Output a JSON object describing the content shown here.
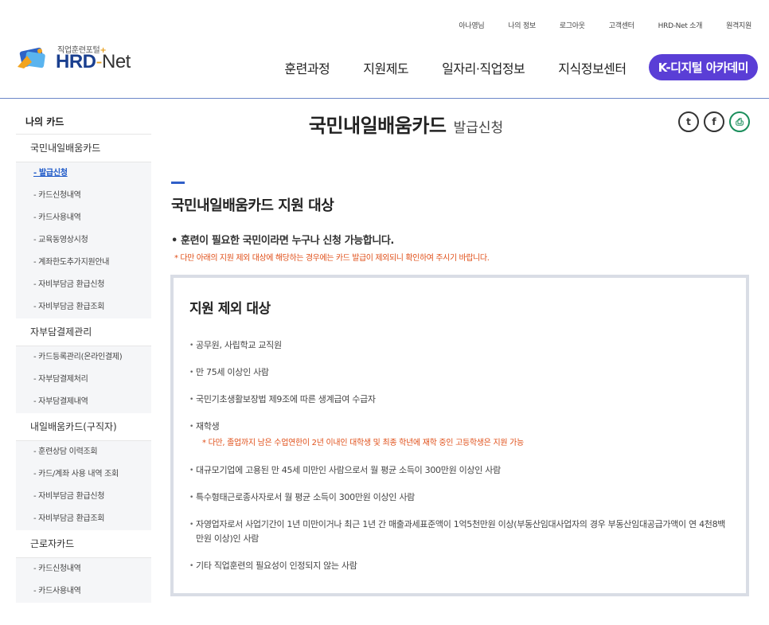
{
  "utility_links": [
    "아나영님",
    "나의 정보",
    "로그아웃",
    "고객센터",
    "HRD-Net 소개",
    "원격지원"
  ],
  "logo": {
    "subtitle": "직업훈련포털",
    "plus": "+",
    "brand_hrd": "HRD",
    "brand_dash": "-",
    "brand_net": "Net"
  },
  "gnb": [
    "훈련과정",
    "지원제도",
    "일자리·직업정보",
    "지식정보센터"
  ],
  "gnb_highlight": "K-디지털 아카데미",
  "sidebar": {
    "title": "나의 카드",
    "groups": [
      {
        "label": "국민내일배움카드",
        "items": [
          "- 발급신청",
          "- 카드신청내역",
          "- 카드사용내역",
          "- 교육동영상시청",
          "- 계좌한도추가지원안내",
          "- 자비부담금 환급신청",
          "- 자비부담금 환급조회"
        ]
      },
      {
        "label": "자부담결제관리",
        "items": [
          "- 카드등록관리(온라인결제)",
          "- 자부담결제처리",
          "- 자부담결제내역"
        ]
      },
      {
        "label": "내일배움카드(구직자)",
        "items": [
          "- 훈련상담 이력조회",
          "- 카드/계좌 사용 내역 조회",
          "- 자비부담금 환급신청",
          "- 자비부담금 환급조회"
        ]
      },
      {
        "label": "근로자카드",
        "items": [
          "- 카드신청내역",
          "- 카드사용내역"
        ]
      }
    ]
  },
  "page_title": {
    "main": "국민내일배움카드",
    "sub": "발급신청"
  },
  "share_icons": [
    "twitter-icon",
    "facebook-icon",
    "print-icon"
  ],
  "section_title": "국민내일배움카드 지원 대상",
  "lead": "훈련이 필요한 국민이라면 누구나 신청 가능합니다.",
  "note": "* 다만 아래의 지원 제외 대상에 해당하는 경우에는 카드 발급이 제외되니 확인하여 주시기 바랍니다.",
  "box": {
    "title": "지원 제외 대상",
    "items": [
      "공무원, 사립학교 교직원",
      "만 75세 이상인 사람",
      "국민기초생활보장법 제9조에 따른 생계급여 수급자",
      "재학생",
      "대규모기업에 고용된 만 45세 미만인 사람으로서 월 평균 소득이 300만원 이상인 사람",
      "특수형태근로종사자로서 월 평균 소득이 300만원 이상인 사람",
      "자영업자로서 사업기간이 1년 미만이거나 최근 1년 간 매출과세표준액이 1억5천만원 이상(부동산임대사업자의 경우 부동산임대공급가액이 연 4천8백만원 이상)인 사람",
      "기타 직업훈련의 필요성이 인정되지 않는 사람"
    ],
    "student_note": "* 다만, 졸업까지 남은 수업연한이 2년 이내인 대학생 및 최종 학년에 재학 중인 고등학생은 지원 가능"
  },
  "colors": {
    "brand_blue": "#1a3f8f",
    "accent_purple": "#5a3ed6",
    "note_red": "#e0501a",
    "active_blue": "#1a56c7"
  }
}
